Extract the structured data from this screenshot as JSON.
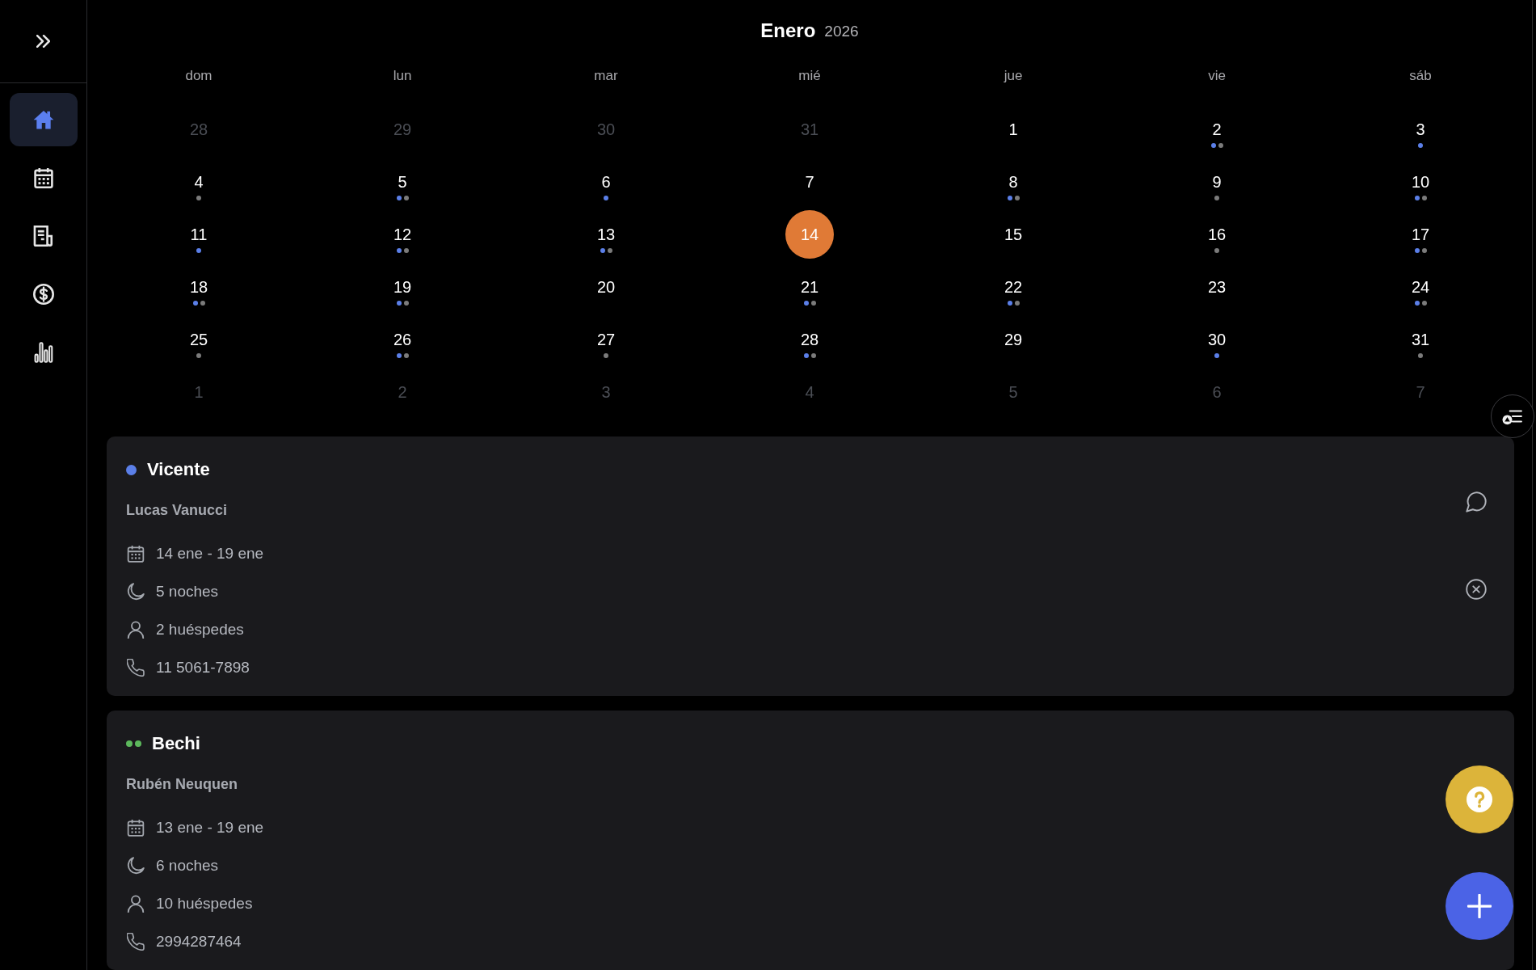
{
  "sidebar": {
    "items": [
      {
        "kind": "home",
        "selected": true
      },
      {
        "kind": "calendar",
        "selected": false
      },
      {
        "kind": "document",
        "selected": false
      },
      {
        "kind": "money",
        "selected": false
      },
      {
        "kind": "chart",
        "selected": false
      }
    ]
  },
  "calendar": {
    "month": "Enero",
    "year": "2026",
    "weekdays": [
      "dom",
      "lun",
      "mar",
      "mié",
      "jue",
      "vie",
      "sáb"
    ],
    "days": [
      {
        "label": "28",
        "outside": true,
        "selected": false
      },
      {
        "label": "29",
        "outside": true,
        "selected": false
      },
      {
        "label": "30",
        "outside": true,
        "selected": false
      },
      {
        "label": "31",
        "outside": true,
        "selected": false
      },
      {
        "label": "1",
        "outside": false,
        "selected": false
      },
      {
        "label": "2",
        "outside": false,
        "selected": false,
        "dots": [
          {
            "color": "#5b7fe8"
          },
          {
            "color": "#7b7b7b"
          }
        ]
      },
      {
        "label": "3",
        "outside": false,
        "selected": false,
        "dots": [
          {
            "color": "#5b7fe8"
          }
        ]
      },
      {
        "label": "4",
        "outside": false,
        "selected": false,
        "dots": [
          {
            "color": "#7b7b7b"
          }
        ]
      },
      {
        "label": "5",
        "outside": false,
        "selected": false,
        "dots": [
          {
            "color": "#5b7fe8"
          },
          {
            "color": "#7b7b7b"
          }
        ]
      },
      {
        "label": "6",
        "outside": false,
        "selected": false,
        "dots": [
          {
            "color": "#5b7fe8"
          }
        ]
      },
      {
        "label": "7",
        "outside": false,
        "selected": false
      },
      {
        "label": "8",
        "outside": false,
        "selected": false,
        "dots": [
          {
            "color": "#5b7fe8"
          },
          {
            "color": "#7b7b7b"
          }
        ]
      },
      {
        "label": "9",
        "outside": false,
        "selected": false,
        "dots": [
          {
            "color": "#7b7b7b"
          }
        ]
      },
      {
        "label": "10",
        "outside": false,
        "selected": false,
        "dots": [
          {
            "color": "#5b7fe8"
          },
          {
            "color": "#7b7b7b"
          }
        ]
      },
      {
        "label": "11",
        "outside": false,
        "selected": false,
        "dots": [
          {
            "color": "#5b7fe8"
          }
        ]
      },
      {
        "label": "12",
        "outside": false,
        "selected": false,
        "dots": [
          {
            "color": "#5b7fe8"
          },
          {
            "color": "#7b7b7b"
          }
        ]
      },
      {
        "label": "13",
        "outside": false,
        "selected": false,
        "dots": [
          {
            "color": "#5b7fe8"
          },
          {
            "color": "#7b7b7b"
          }
        ]
      },
      {
        "label": "14",
        "outside": false,
        "selected": true
      },
      {
        "label": "15",
        "outside": false,
        "selected": false
      },
      {
        "label": "16",
        "outside": false,
        "selected": false,
        "dots": [
          {
            "color": "#7b7b7b"
          }
        ]
      },
      {
        "label": "17",
        "outside": false,
        "selected": false,
        "dots": [
          {
            "color": "#5b7fe8"
          },
          {
            "color": "#7b7b7b"
          }
        ]
      },
      {
        "label": "18",
        "outside": false,
        "selected": false,
        "dots": [
          {
            "color": "#5b7fe8"
          },
          {
            "color": "#7b7b7b"
          }
        ]
      },
      {
        "label": "19",
        "outside": false,
        "selected": false,
        "dots": [
          {
            "color": "#5b7fe8"
          },
          {
            "color": "#7b7b7b"
          }
        ]
      },
      {
        "label": "20",
        "outside": false,
        "selected": false
      },
      {
        "label": "21",
        "outside": false,
        "selected": false,
        "dots": [
          {
            "color": "#5b7fe8"
          },
          {
            "color": "#7b7b7b"
          }
        ]
      },
      {
        "label": "22",
        "outside": false,
        "selected": false,
        "dots": [
          {
            "color": "#5b7fe8"
          },
          {
            "color": "#7b7b7b"
          }
        ]
      },
      {
        "label": "23",
        "outside": false,
        "selected": false
      },
      {
        "label": "24",
        "outside": false,
        "selected": false,
        "dots": [
          {
            "color": "#5b7fe8"
          },
          {
            "color": "#7b7b7b"
          }
        ]
      },
      {
        "label": "25",
        "outside": false,
        "selected": false,
        "dots": [
          {
            "color": "#7b7b7b"
          }
        ]
      },
      {
        "label": "26",
        "outside": false,
        "selected": false,
        "dots": [
          {
            "color": "#5b7fe8"
          },
          {
            "color": "#7b7b7b"
          }
        ]
      },
      {
        "label": "27",
        "outside": false,
        "selected": false,
        "dots": [
          {
            "color": "#7b7b7b"
          }
        ]
      },
      {
        "label": "28",
        "outside": false,
        "selected": false,
        "dots": [
          {
            "color": "#5b7fe8"
          },
          {
            "color": "#7b7b7b"
          }
        ]
      },
      {
        "label": "29",
        "outside": false,
        "selected": false
      },
      {
        "label": "30",
        "outside": false,
        "selected": false,
        "dots": [
          {
            "color": "#5b7fe8"
          }
        ]
      },
      {
        "label": "31",
        "outside": false,
        "selected": false,
        "dots": [
          {
            "color": "#7b7b7b"
          }
        ]
      },
      {
        "label": "1",
        "outside": true,
        "selected": false
      },
      {
        "label": "2",
        "outside": true,
        "selected": false
      },
      {
        "label": "3",
        "outside": true,
        "selected": false
      },
      {
        "label": "4",
        "outside": true,
        "selected": false
      },
      {
        "label": "5",
        "outside": true,
        "selected": false
      },
      {
        "label": "6",
        "outside": true,
        "selected": false
      },
      {
        "label": "7",
        "outside": true,
        "selected": false
      }
    ]
  },
  "reservations": [
    {
      "dots": [
        {
          "color": "#5b7fe8"
        }
      ],
      "title": "Vicente",
      "guest": "Lucas Vanucci",
      "details": [
        {
          "kind": "dates",
          "text": "14 ene - 19 ene"
        },
        {
          "kind": "nights",
          "text": "5 noches"
        },
        {
          "kind": "guests",
          "text": "2 huéspedes"
        },
        {
          "kind": "phone",
          "text": "11 5061-7898"
        }
      ],
      "actions": [
        {
          "kind": "chat"
        },
        {
          "kind": "cancel"
        }
      ]
    },
    {
      "dots": [
        {
          "color": "#5cb85c"
        },
        {
          "color": "#5cb85c"
        }
      ],
      "title": "Bechi",
      "guest": "Rubén Neuquen",
      "details": [
        {
          "kind": "dates",
          "text": "13 ene - 19 ene"
        },
        {
          "kind": "nights",
          "text": "6 noches"
        },
        {
          "kind": "guests",
          "text": "10 huéspedes"
        },
        {
          "kind": "phone",
          "text": "2994287464"
        }
      ]
    }
  ],
  "floating_buttons": [
    {
      "kind": "list"
    },
    {
      "kind": "help"
    },
    {
      "kind": "add"
    }
  ]
}
